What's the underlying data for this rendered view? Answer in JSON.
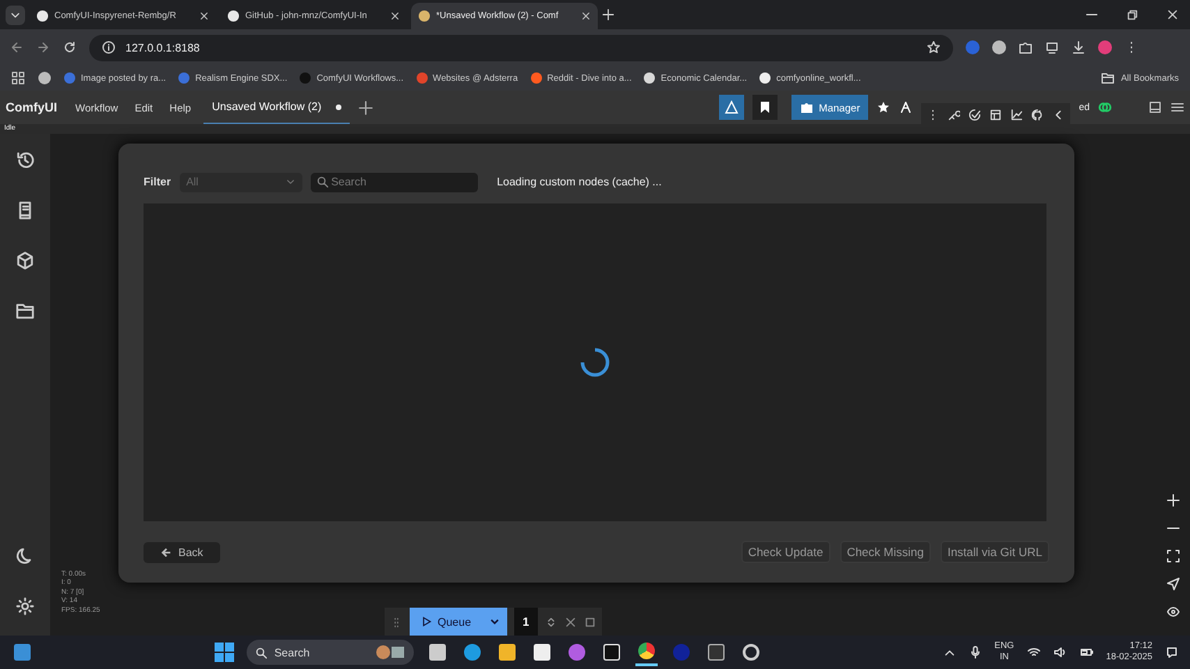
{
  "browser_tabs": [
    {
      "title": "ComfyUI-Inspyrenet-Rembg/R",
      "selected": false
    },
    {
      "title": "GitHub - john-mnz/ComfyUI-In",
      "selected": false
    },
    {
      "title": "*Unsaved Workflow (2) - Comf",
      "selected": true
    }
  ],
  "address": "127.0.0.1:8188",
  "bookmarks": [
    {
      "label": "Image posted by ra...",
      "color": "#3b6fd8"
    },
    {
      "label": "Realism Engine SDX...",
      "color": "#3b6fd8"
    },
    {
      "label": "ComfyUI Workflows...",
      "color": "#111111"
    },
    {
      "label": "Websites @ Adsterra",
      "color": "#e0442a"
    },
    {
      "label": "Reddit - Dive into a...",
      "color": "#ff5a1f"
    },
    {
      "label": "Economic Calendar...",
      "color": "#d8d8d8"
    },
    {
      "label": "comfyonline_workfl...",
      "color": "#eeeeee"
    }
  ],
  "all_bookmarks": "All Bookmarks",
  "app": {
    "logo": "ComfyUI",
    "menu": [
      "Workflow",
      "Edit",
      "Help"
    ],
    "workflow_tab": {
      "title": "Unsaved Workflow (2)",
      "unsaved": true
    },
    "manager_button": "Manager",
    "cut_label": "ed"
  },
  "status": "Idle",
  "dialog": {
    "filter_label": "Filter",
    "filter_value": "All",
    "search_placeholder": "Search",
    "loading_message": "Loading custom nodes (cache) ...",
    "back_button": "Back",
    "buttons": [
      "Check Update",
      "Check Missing",
      "Install via Git URL"
    ]
  },
  "stats": [
    "T: 0.00s",
    "I: 0",
    "N: 7 [0]",
    "V: 14",
    "FPS: 166.25"
  ],
  "queue": {
    "label": "Queue",
    "count": "1"
  },
  "taskbar": {
    "search_placeholder": "Search",
    "language": "ENG",
    "region": "IN",
    "time": "17:12",
    "date": "18-02-2025"
  }
}
